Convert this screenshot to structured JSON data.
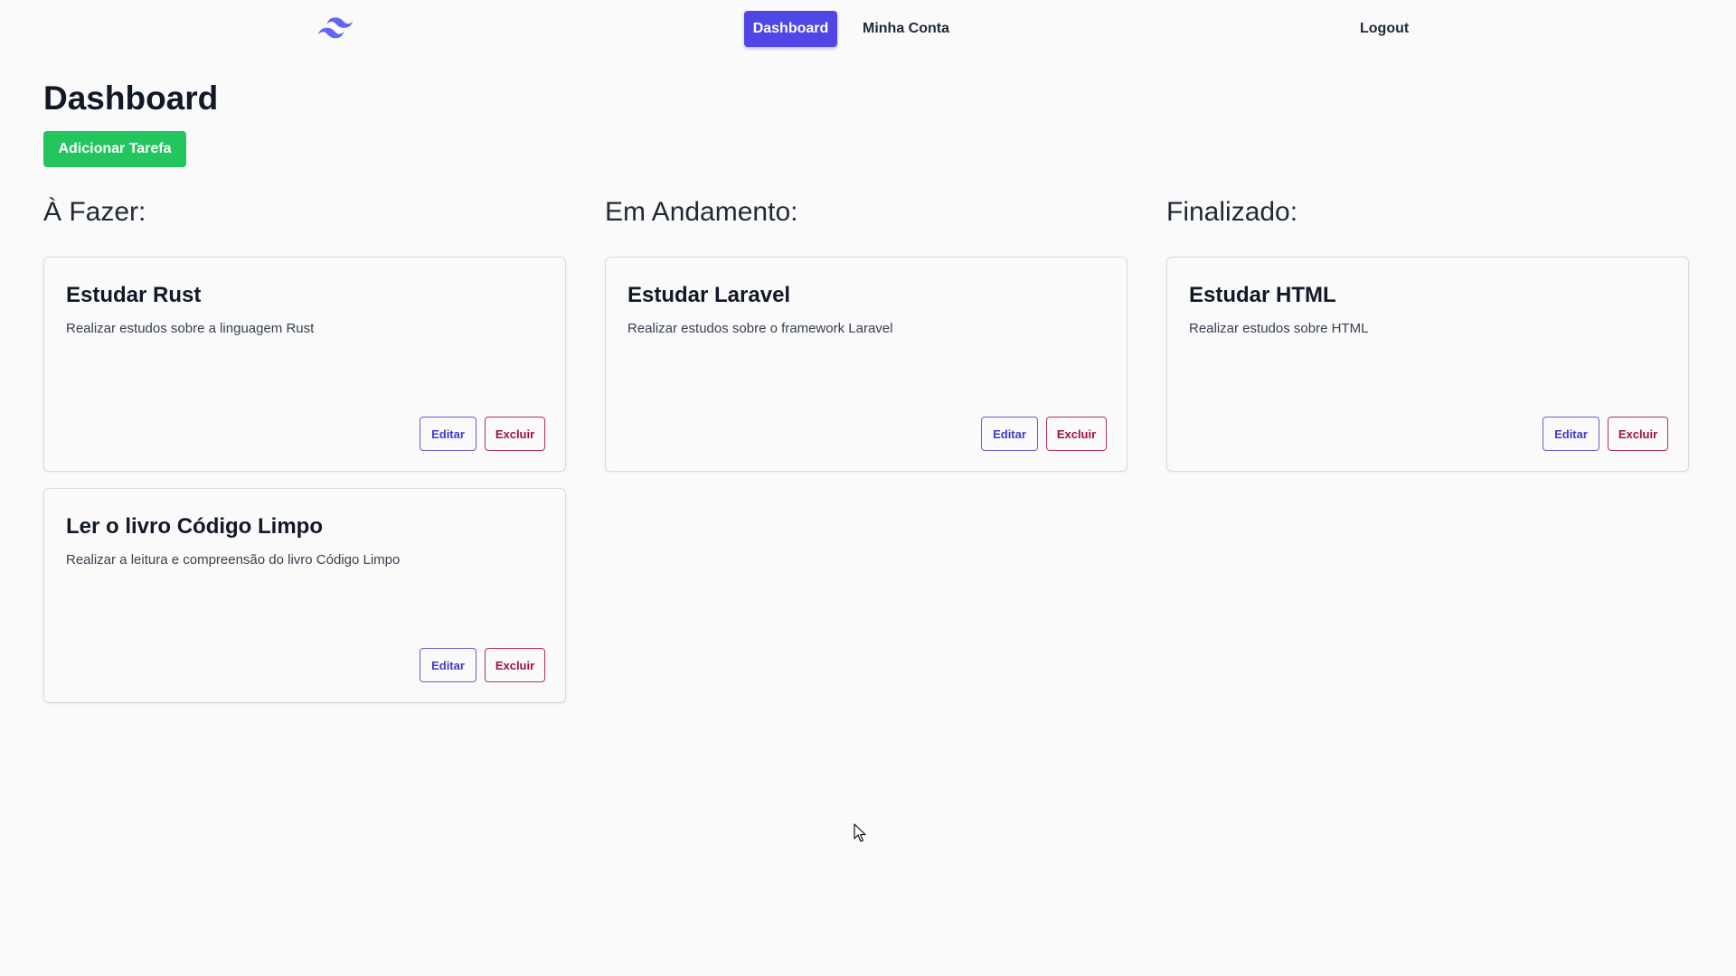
{
  "nav": {
    "logo_icon": "tailwind-wave-icon",
    "dashboard_label": "Dashboard",
    "account_label": "Minha Conta",
    "logout_label": "Logout",
    "accent_color": "#4f46e5"
  },
  "page": {
    "title": "Dashboard",
    "add_label": "Adicionar Tarefa",
    "add_color": "#22c55e"
  },
  "columns": [
    {
      "title": "À Fazer:",
      "cards": [
        {
          "title": "Estudar Rust",
          "description": "Realizar estudos sobre a linguagem Rust",
          "edit_label": "Editar",
          "delete_label": "Excluir"
        },
        {
          "title": "Ler o livro Código Limpo",
          "description": "Realizar a leitura e compreensão do livro Código Limpo",
          "edit_label": "Editar",
          "delete_label": "Excluir"
        }
      ]
    },
    {
      "title": "Em Andamento:",
      "cards": [
        {
          "title": "Estudar Laravel",
          "description": "Realizar estudos sobre o framework Laravel",
          "edit_label": "Editar",
          "delete_label": "Excluir"
        }
      ]
    },
    {
      "title": "Finalizado:",
      "cards": [
        {
          "title": "Estudar HTML",
          "description": "Realizar estudos sobre HTML",
          "edit_label": "Editar",
          "delete_label": "Excluir"
        }
      ]
    }
  ]
}
